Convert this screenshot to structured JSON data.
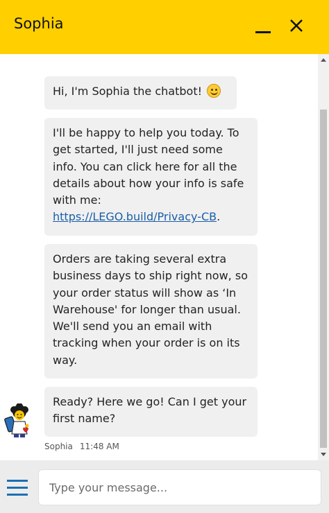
{
  "header": {
    "title": "Sophia",
    "minimize_icon": "minimize-icon",
    "close_icon": "close-icon",
    "background": "#ffcf00"
  },
  "messages": [
    {
      "text": "Hi, I'm Sophia the chatbot!",
      "emoji": "smiling-face-icon"
    },
    {
      "text": "I'll be happy to help you today. To get started, I'll just need some info. You can click here for all the details about how your info is safe with me: ",
      "link": "https://LEGO.build/Privacy-CB",
      "after_link": "."
    },
    {
      "text": "Orders are taking several extra business days to ship right now, so your order status will show as ‘In Warehouse' for longer than usual. We'll send you an email with tracking when your order is on its way."
    },
    {
      "text": "Ready? Here we go! Can I get your first name?"
    }
  ],
  "meta": {
    "sender": "Sophia",
    "time": "11:48 AM"
  },
  "composer": {
    "placeholder": "Type your message...",
    "value": "",
    "menu_icon": "hamburger-menu-icon",
    "accent": "#1a6fb3"
  }
}
